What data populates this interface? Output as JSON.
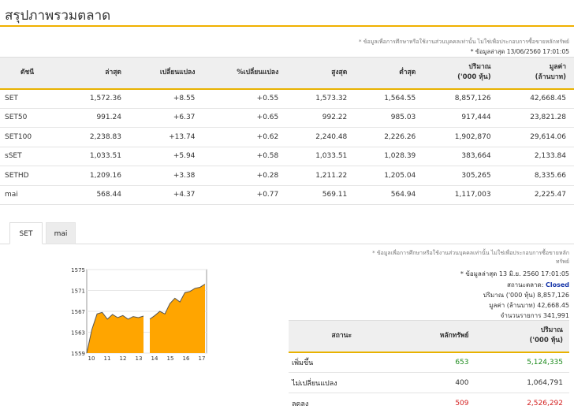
{
  "header": {
    "title": "สรุปภาพรวมตลาด"
  },
  "summary": {
    "disclaimer": "* ข้อมูลเพื่อการศึกษาหรือใช้งานส่วนบุคคลเท่านั้น ไม่ใช่เพื่อประกอบการซื้อขายหลักทรัพย์",
    "updated": "* ข้อมูลล่าสุด 13/06/2560 17:01:05",
    "columns": {
      "index": "ดัชนี",
      "last": "ล่าสุด",
      "change": "เปลี่ยนแปลง",
      "pct_change": "%เปลี่ยนแปลง",
      "high": "สูงสุด",
      "low": "ต่ำสุด",
      "volume_1": "ปริมาณ",
      "volume_2": "('000 หุ้น)",
      "value_1": "มูลค่า",
      "value_2": "(ล้านบาท)"
    },
    "rows": [
      {
        "name": "SET",
        "last": "1,572.36",
        "change": "+8.55",
        "pct": "+0.55",
        "high": "1,573.32",
        "low": "1,564.55",
        "volume": "8,857,126",
        "value": "42,668.45"
      },
      {
        "name": "SET50",
        "last": "991.24",
        "change": "+6.37",
        "pct": "+0.65",
        "high": "992.22",
        "low": "985.03",
        "volume": "917,444",
        "value": "23,821.28"
      },
      {
        "name": "SET100",
        "last": "2,238.83",
        "change": "+13.74",
        "pct": "+0.62",
        "high": "2,240.48",
        "low": "2,226.26",
        "volume": "1,902,870",
        "value": "29,614.06"
      },
      {
        "name": "sSET",
        "last": "1,033.51",
        "change": "+5.94",
        "pct": "+0.58",
        "high": "1,033.51",
        "low": "1,028.39",
        "volume": "383,664",
        "value": "2,133.84"
      },
      {
        "name": "SETHD",
        "last": "1,209.16",
        "change": "+3.38",
        "pct": "+0.28",
        "high": "1,211.22",
        "low": "1,205.04",
        "volume": "305,265",
        "value": "8,335.66"
      },
      {
        "name": "mai",
        "last": "568.44",
        "change": "+4.37",
        "pct": "+0.77",
        "high": "569.11",
        "low": "564.94",
        "volume": "1,117,003",
        "value": "2,225.47"
      }
    ]
  },
  "tabs": [
    {
      "label": "SET"
    },
    {
      "label": "mai"
    }
  ],
  "chart_data": {
    "type": "area",
    "x_ticks": [
      "10",
      "11",
      "12",
      "13",
      "14",
      "15",
      "16",
      "17"
    ],
    "y_ticks": [
      "1575",
      "1571",
      "1567",
      "1563",
      "1559"
    ],
    "ylim": [
      1559,
      1575
    ],
    "series": [
      {
        "session": "morning",
        "values": [
          1559,
          1563.5,
          1566.5,
          1566.8,
          1565.5,
          1566.4,
          1565.8,
          1566.2,
          1565.5,
          1566.0,
          1565.8,
          1566.1
        ]
      },
      {
        "session": "afternoon",
        "values": [
          1565.5,
          1566.2,
          1567.0,
          1566.5,
          1568.5,
          1569.5,
          1568.8,
          1570.6,
          1570.8,
          1571.4,
          1571.6,
          1572.2
        ]
      }
    ],
    "colors": {
      "fill": "#ffa500",
      "line": "#555555"
    }
  },
  "market_info": {
    "disclaimer_1": "* ข้อมูลเพื่อการศึกษาหรือใช้งานส่วนบุคคลเท่านั้น ไม่ใช่เพื่อประกอบการซื้อขายหลัก",
    "disclaimer_2": "ทรัพย์",
    "updated": "* ข้อมูลล่าสุด 13 มิ.ย. 2560 17:01:05",
    "status_label": "สถานะตลาด:",
    "status_value": "Closed",
    "volume_label": "ปริมาณ ('000 หุ้น)",
    "volume_value": "8,857,126",
    "value_label": "มูลค่า (ล้านบาท)",
    "value_value": "42,668.45",
    "trades_label": "จำนวนรายการ",
    "trades_value": "341,991"
  },
  "breadth": {
    "columns": {
      "status": "สถานะ",
      "securities": "หลักทรัพย์",
      "volume_1": "ปริมาณ",
      "volume_2": "('000 หุ้น)"
    },
    "rows": [
      {
        "label": "เพิ่มขึ้น",
        "count": "653",
        "volume": "5,124,335",
        "color": "#1c8a1c"
      },
      {
        "label": "ไม่เปลี่ยนแปลง",
        "count": "400",
        "volume": "1,064,791",
        "color": "#333333"
      },
      {
        "label": "ลดลง",
        "count": "509",
        "volume": "2,526,292",
        "color": "#d42020"
      }
    ]
  }
}
